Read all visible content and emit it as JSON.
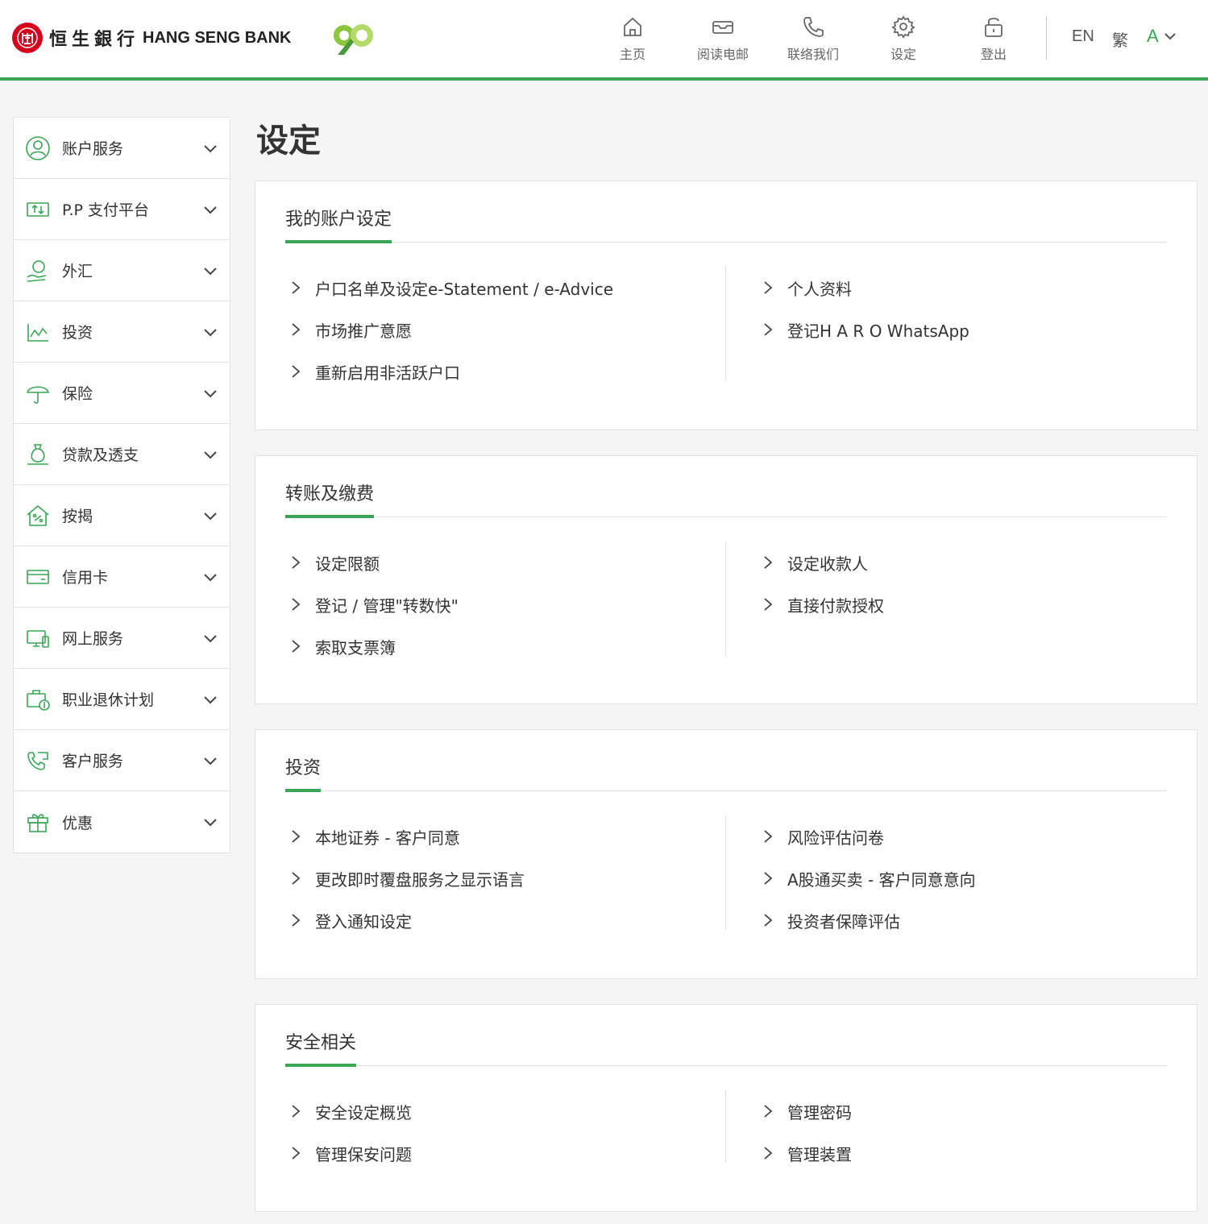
{
  "header": {
    "brand_cn": "恒生銀行",
    "brand_en": "HANG SENG BANK",
    "nav": [
      {
        "label": "主页",
        "icon": "home-icon"
      },
      {
        "label": "阅读电邮",
        "icon": "inbox-icon"
      },
      {
        "label": "联络我们",
        "icon": "phone-icon"
      },
      {
        "label": "设定",
        "icon": "gear-icon"
      },
      {
        "label": "登出",
        "icon": "unlock-icon"
      }
    ],
    "lang_en": "EN",
    "lang_tc": "繁",
    "font_size": "A"
  },
  "sidebar": {
    "items": [
      {
        "label": "账户服务",
        "icon": "user-circle-icon"
      },
      {
        "label": "P.P 支付平台",
        "icon": "money-transfer-icon"
      },
      {
        "label": "外汇",
        "icon": "fx-icon"
      },
      {
        "label": "投资",
        "icon": "chart-line-icon"
      },
      {
        "label": "保险",
        "icon": "umbrella-icon"
      },
      {
        "label": "贷款及透支",
        "icon": "money-bag-icon"
      },
      {
        "label": "按揭",
        "icon": "house-percent-icon"
      },
      {
        "label": "信用卡",
        "icon": "credit-card-icon"
      },
      {
        "label": "网上服务",
        "icon": "devices-icon"
      },
      {
        "label": "职业退休计划",
        "icon": "briefcase-dollar-icon"
      },
      {
        "label": "客户服务",
        "icon": "phone-support-icon"
      },
      {
        "label": "优惠",
        "icon": "gift-icon"
      }
    ]
  },
  "main": {
    "title": "设定",
    "sections": [
      {
        "title": "我的账户设定",
        "left": [
          "户口名单及设定e-Statement / e-Advice",
          "市场推广意愿",
          "重新启用非活跃户口"
        ],
        "right": [
          "个人资料",
          "登记H A R O WhatsApp"
        ]
      },
      {
        "title": "转账及缴费",
        "left": [
          "设定限额",
          "登记 / 管理\"转数快\"",
          "索取支票簿"
        ],
        "right": [
          "设定收款人",
          "直接付款授权"
        ]
      },
      {
        "title": "投资",
        "left": [
          "本地证券 - 客户同意",
          "更改即时覆盘服务之显示语言",
          "登入通知设定"
        ],
        "right": [
          "风险评估问卷",
          "A股通买卖 - 客户同意意向",
          "投资者保障评估"
        ]
      },
      {
        "title": "安全相关",
        "left": [
          "安全设定概览",
          "管理保安问题"
        ],
        "right": [
          "管理密码",
          "管理装置"
        ]
      }
    ]
  },
  "colors": {
    "accent": "#3aa655",
    "brand_red": "#d6001c"
  }
}
